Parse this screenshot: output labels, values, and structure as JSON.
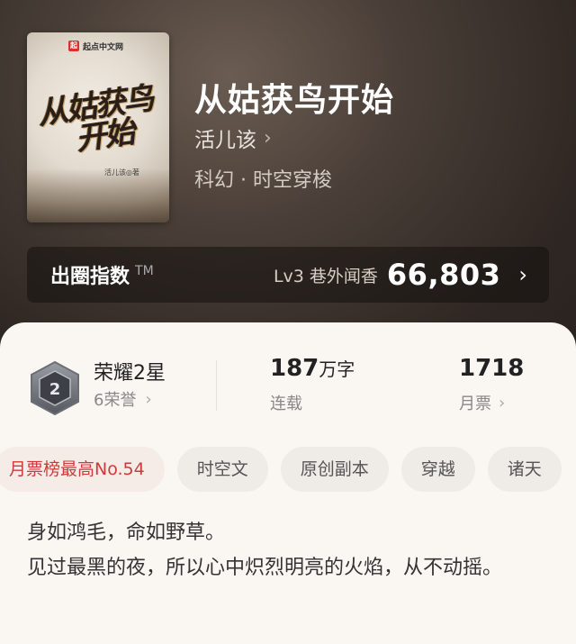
{
  "book": {
    "title": "从姑获鸟开始",
    "author": "活儿该",
    "genre": "科幻 · 时空穿梭",
    "cover": {
      "logo_mark": "起",
      "logo_text": "起点中文网",
      "title_line1": "从姑获鸟",
      "title_line2": "开始",
      "author": "活儿该◎著"
    }
  },
  "index_card": {
    "label": "出圈指数",
    "tm": "TM",
    "level": "Lv3 巷外闻香",
    "value": "66,803"
  },
  "stats": {
    "rank_title": "荣耀2星",
    "rank_sub": "6荣誉",
    "rank_badge_num": "2",
    "words_value": "187",
    "words_unit": "万字",
    "words_sub": "连载",
    "tickets_value": "1718",
    "tickets_sub": "月票"
  },
  "tags": [
    "月票榜最高No.54",
    "时空文",
    "原创副本",
    "穿越",
    "诸天"
  ],
  "synopsis": {
    "line1": "身如鸿毛，命如野草。",
    "line2": "见过最黑的夜，所以心中炽烈明亮的火焰，从不动摇。"
  },
  "colors": {
    "accent_red": "#d0393b",
    "panel_bg": "#faf6f2",
    "header_bg": "#2b2420"
  },
  "icons": {
    "chevron": "chevron-right-icon",
    "badge": "honor-badge-icon"
  }
}
